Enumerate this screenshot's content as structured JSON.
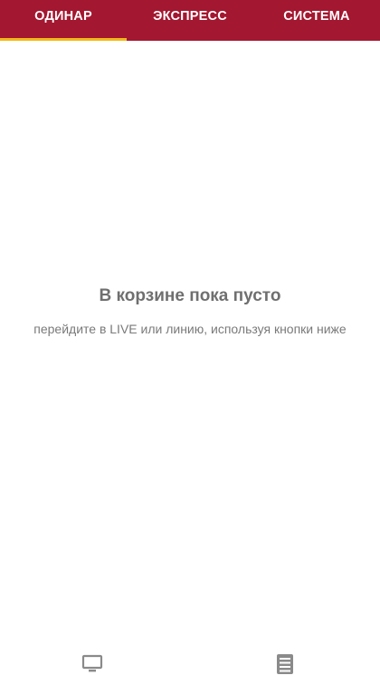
{
  "tabs": [
    {
      "label": "ОДИНАР",
      "active": true
    },
    {
      "label": "ЭКСПРЕСС",
      "active": false
    },
    {
      "label": "СИСТЕМА",
      "active": false
    }
  ],
  "empty_state": {
    "title": "В корзине пока пусто",
    "subtitle": "перейдите в LIVE или линию, используя кнопки ниже"
  },
  "bottom_nav": {
    "items": [
      {
        "icon": "tv-icon"
      },
      {
        "icon": "list-icon"
      }
    ]
  },
  "colors": {
    "header_bg": "#a31730",
    "active_indicator": "#f2b81a",
    "text_muted": "#6f6f6f"
  }
}
